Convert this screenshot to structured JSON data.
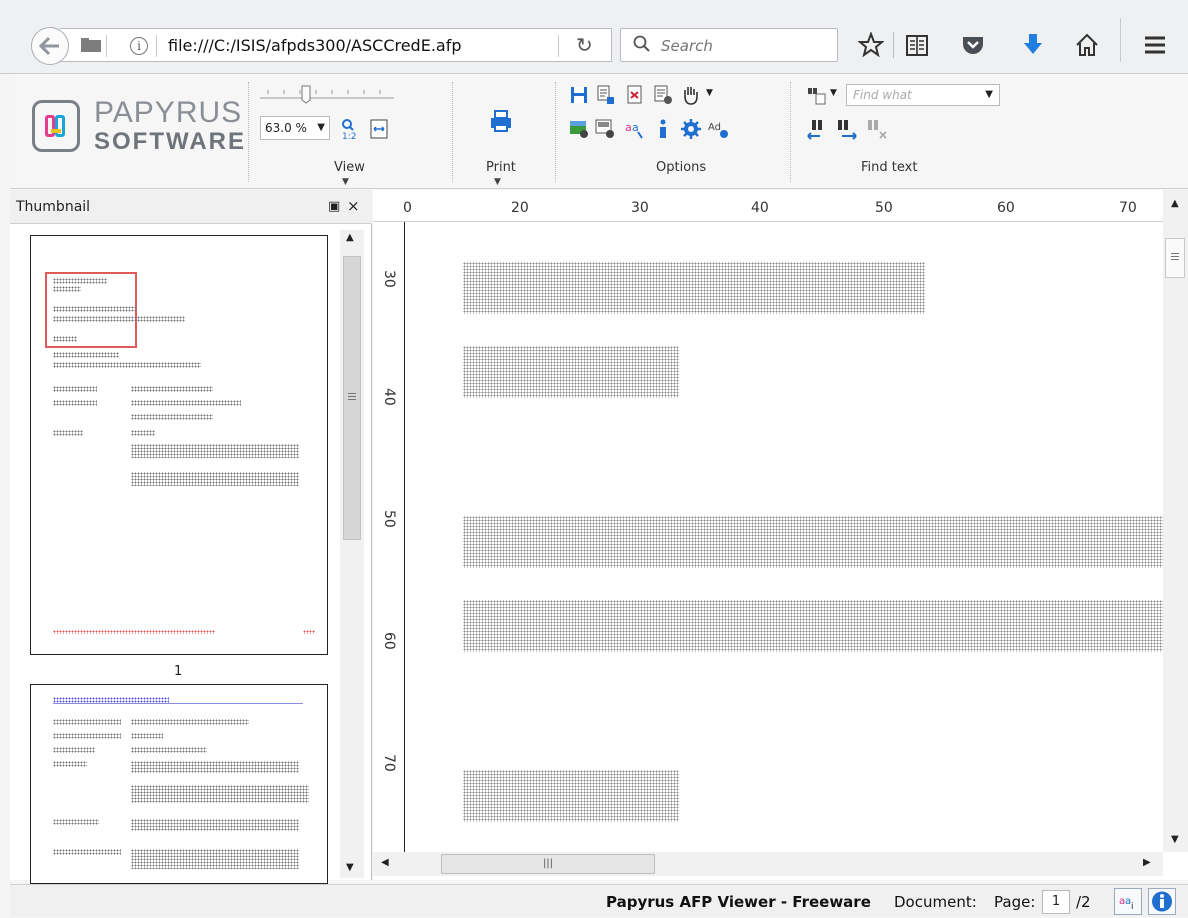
{
  "browser": {
    "url": "file:///C:/ISIS/afpds300/ASCCredE.afp",
    "search_placeholder": "Search"
  },
  "ribbon": {
    "logo_line1": "PAPYRUS",
    "logo_line2": "SOFTWARE",
    "zoom_value": "63.0 %",
    "view_label": "View",
    "print_label": "Print",
    "options_label": "Options",
    "find_label": "Find text",
    "find_placeholder": "Find what"
  },
  "thumbnail": {
    "title": "Thumbnail",
    "page_number": "1"
  },
  "ruler": {
    "h_labels": [
      "0",
      "20",
      "30",
      "40",
      "50",
      "60",
      "70"
    ],
    "v_labels": [
      "30",
      "40",
      "50",
      "60",
      "70"
    ]
  },
  "status": {
    "title": "Papyrus AFP Viewer - Freeware",
    "document_label": "Document:",
    "page_label": "Page:",
    "page_value": "1",
    "page_total": "/2"
  },
  "colors": {
    "accent_blue": "#1f7ee0",
    "thumb_highlight": "#e05a5a"
  }
}
